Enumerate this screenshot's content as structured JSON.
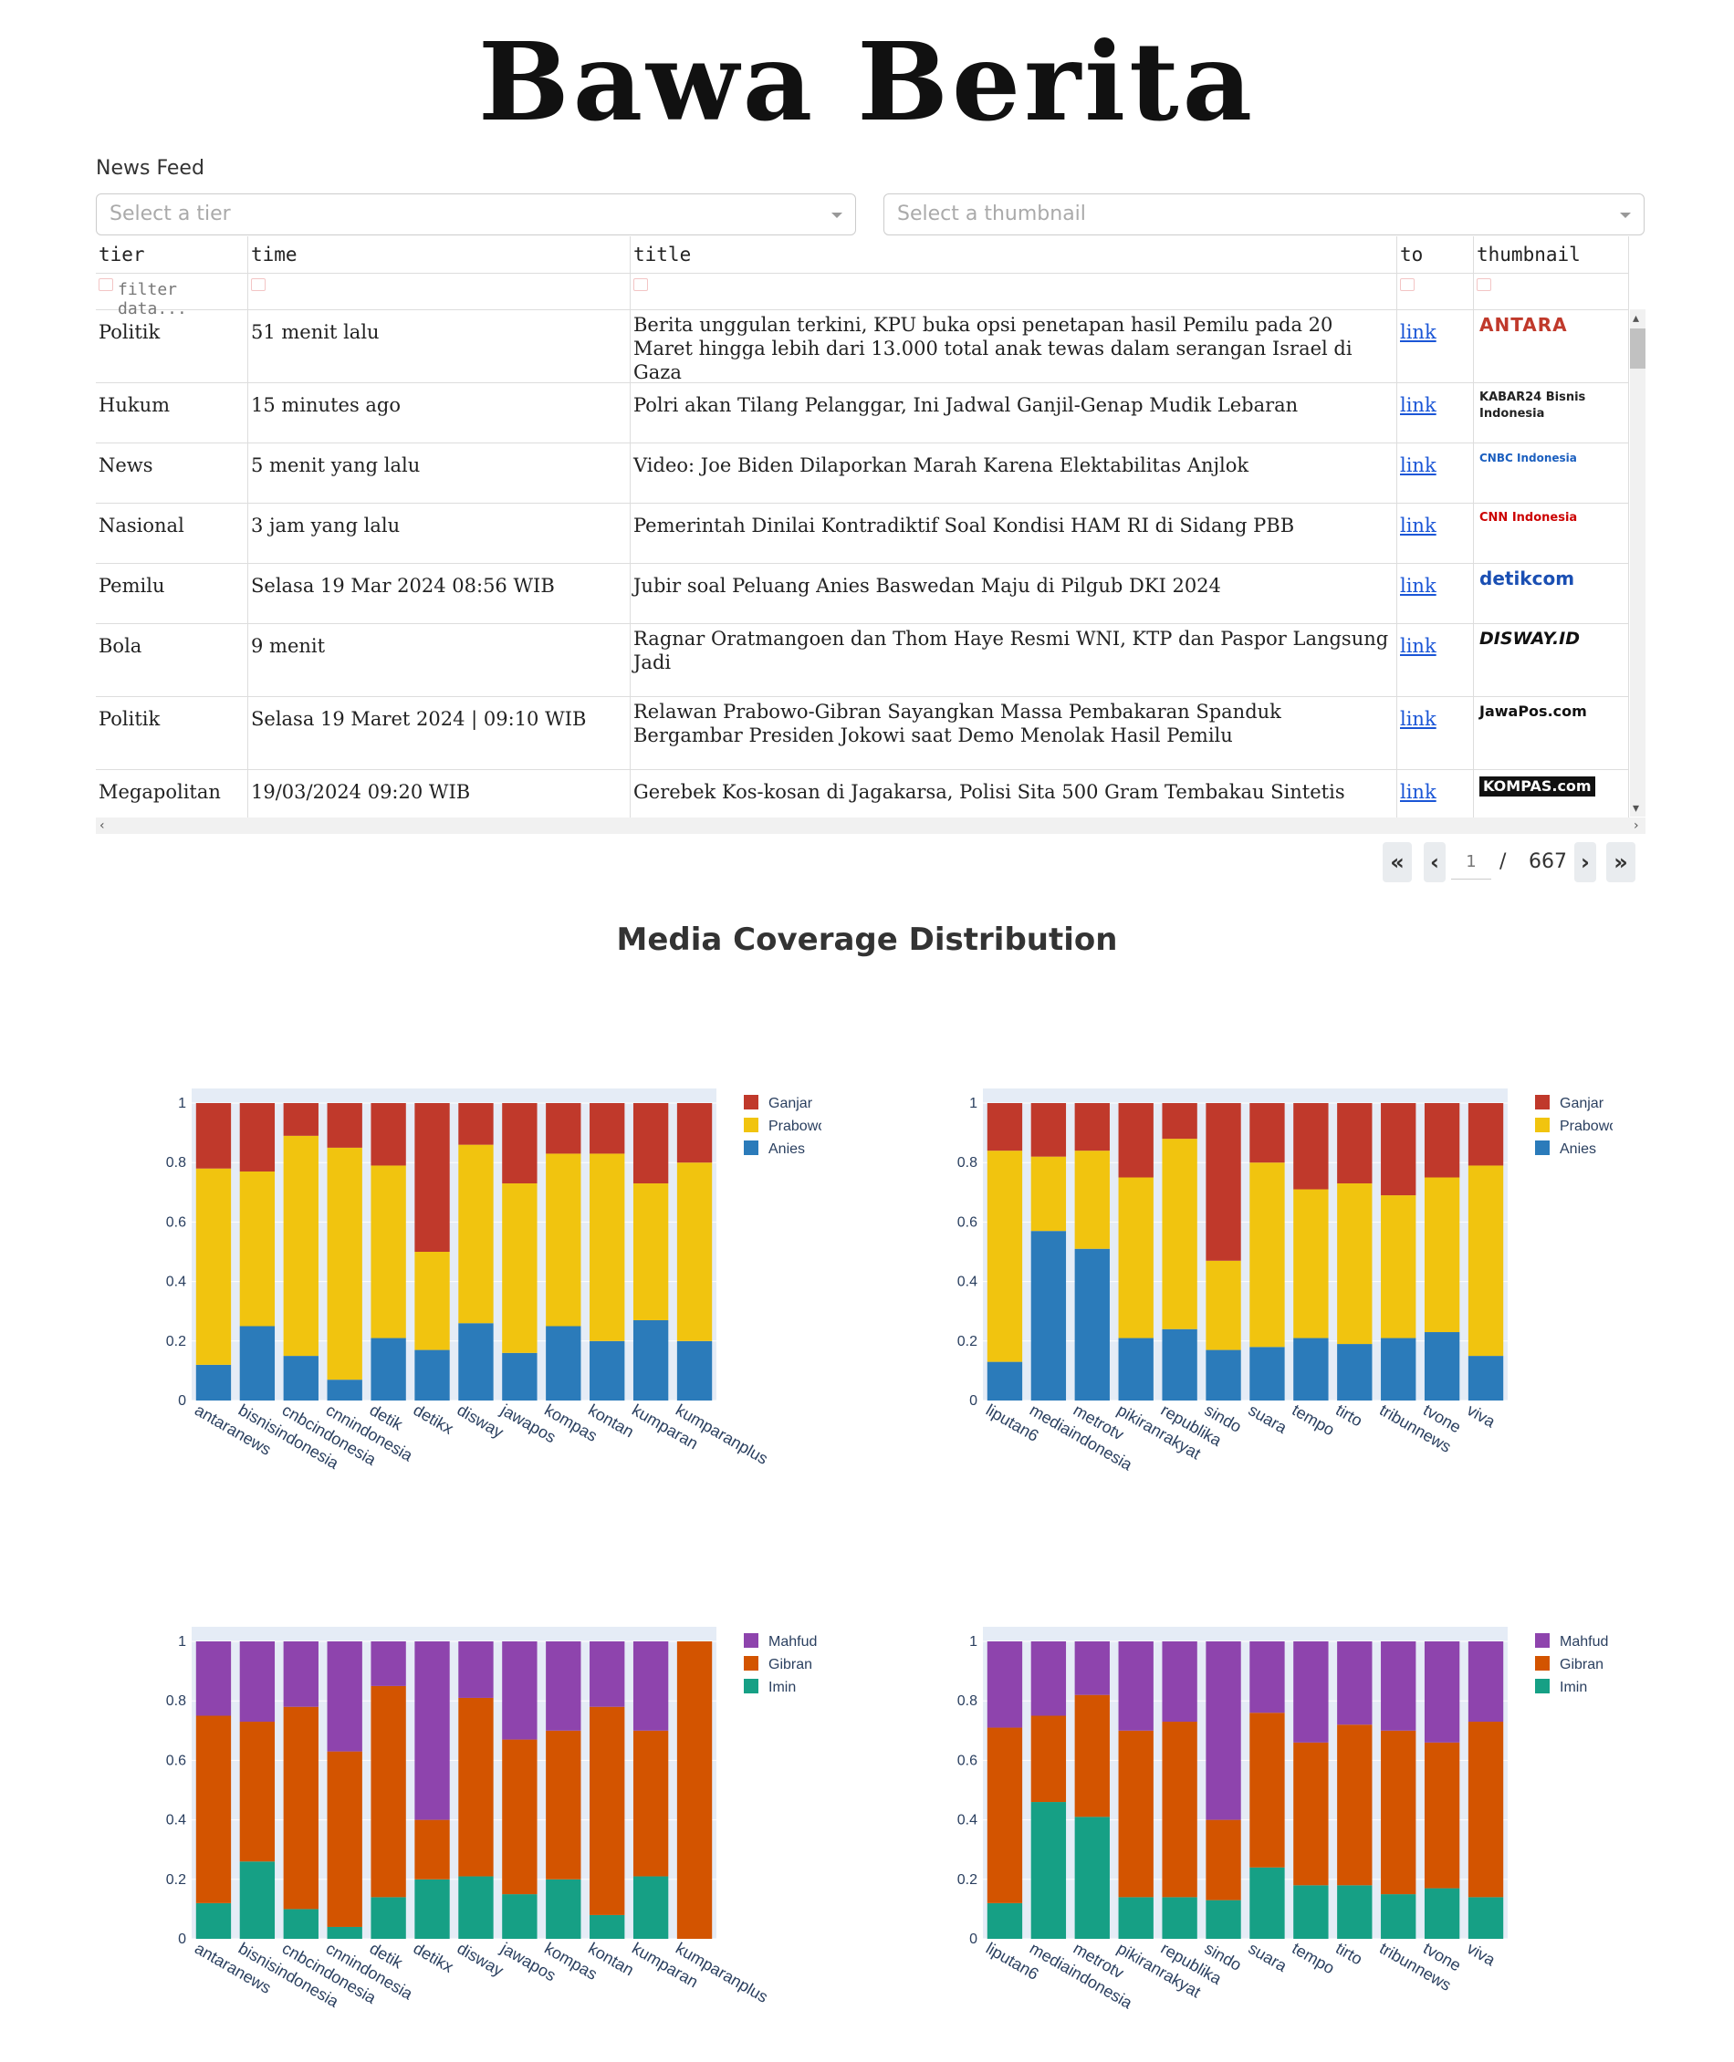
{
  "brand": {
    "title": "Bawa Berita"
  },
  "feed": {
    "label": "News Feed",
    "tier_select_placeholder": "Select a tier",
    "thumbnail_select_placeholder": "Select a thumbnail"
  },
  "table": {
    "columns": [
      "tier",
      "time",
      "title",
      "to",
      "thumbnail"
    ],
    "filter_placeholder": "filter data...",
    "rows": [
      {
        "tier": "Politik",
        "time": "51 menit lalu",
        "title": "Berita unggulan terkini, KPU buka opsi penetapan hasil Pemilu pada 20 Maret hingga lebih dari 13.000 total anak tewas dalam serangan Israel di Gaza",
        "to": "link",
        "thumbnail": "ANTARA"
      },
      {
        "tier": "Hukum",
        "time": "15 minutes ago",
        "title": "Polri akan Tilang Pelanggar, Ini Jadwal Ganjil-Genap Mudik Lebaran",
        "to": "link",
        "thumbnail": "KABAR24 Bisnis Indonesia"
      },
      {
        "tier": "News",
        "time": "5 menit yang lalu",
        "title": "Video: Joe Biden Dilaporkan Marah Karena Elektabilitas Anjlok",
        "to": "link",
        "thumbnail": "CNBC Indonesia"
      },
      {
        "tier": "Nasional",
        "time": "3 jam yang lalu",
        "title": "Pemerintah Dinilai Kontradiktif Soal Kondisi HAM RI di Sidang PBB",
        "to": "link",
        "thumbnail": "CNN Indonesia"
      },
      {
        "tier": "Pemilu",
        "time": "Selasa 19 Mar 2024 08:56 WIB",
        "title": "Jubir soal Peluang Anies Baswedan Maju di Pilgub DKI 2024",
        "to": "link",
        "thumbnail": "detikcom"
      },
      {
        "tier": "Bola",
        "time": "9 menit",
        "title": "Ragnar Oratmangoen dan Thom Haye Resmi WNI, KTP dan Paspor Langsung Jadi",
        "to": "link",
        "thumbnail": "DISWAY.ID"
      },
      {
        "tier": "Politik",
        "time": "Selasa 19 Maret 2024 | 09:10 WIB",
        "title": "Relawan Prabowo-Gibran Sayangkan Massa Pembakaran Spanduk Bergambar Presiden Jokowi saat Demo Menolak Hasil Pemilu",
        "to": "link",
        "thumbnail": "JawaPos.com"
      },
      {
        "tier": "Megapolitan",
        "time": "19/03/2024 09:20 WIB",
        "title": "Gerebek Kos-kosan di Jagakarsa, Polisi Sita 500 Gram Tembakau Sintetis",
        "to": "link",
        "thumbnail": "KOMPAS.com"
      }
    ]
  },
  "pager": {
    "current": "1",
    "slash": "/",
    "total": "667"
  },
  "section_title": "Media Coverage Distribution",
  "chart_data": [
    {
      "type": "bar",
      "stacked": true,
      "categories": [
        "antaranews",
        "bisnisindonesia",
        "cnbcindonesia",
        "cnnindonesia",
        "detik",
        "detikx",
        "disway",
        "jawapos",
        "kompas",
        "kontan",
        "kumparan",
        "kumparanplus"
      ],
      "series": [
        {
          "name": "Anies",
          "color": "#2b7bba",
          "values": [
            0.12,
            0.25,
            0.15,
            0.07,
            0.21,
            0.17,
            0.26,
            0.16,
            0.25,
            0.2,
            0.27,
            0.2
          ]
        },
        {
          "name": "Prabowo",
          "color": "#f1c40f",
          "values": [
            0.66,
            0.52,
            0.74,
            0.78,
            0.58,
            0.33,
            0.6,
            0.57,
            0.58,
            0.63,
            0.46,
            0.6
          ]
        },
        {
          "name": "Ganjar",
          "color": "#c0392b",
          "values": [
            0.22,
            0.23,
            0.11,
            0.15,
            0.21,
            0.5,
            0.14,
            0.27,
            0.17,
            0.17,
            0.27,
            0.2
          ]
        }
      ],
      "ylim": [
        0,
        1
      ],
      "yticks": [
        "0",
        "0.2",
        "0.4",
        "0.6",
        "0.8",
        "1"
      ],
      "legend": "top-right"
    },
    {
      "type": "bar",
      "stacked": true,
      "categories": [
        "liputan6",
        "mediaindonesia",
        "metrotv",
        "pikiranrakyat",
        "republika",
        "sindo",
        "suara",
        "tempo",
        "tirto",
        "tribunnews",
        "tvone",
        "viva"
      ],
      "series": [
        {
          "name": "Anies",
          "color": "#2b7bba",
          "values": [
            0.13,
            0.57,
            0.51,
            0.21,
            0.24,
            0.17,
            0.18,
            0.21,
            0.19,
            0.21,
            0.23,
            0.15
          ]
        },
        {
          "name": "Prabowo",
          "color": "#f1c40f",
          "values": [
            0.71,
            0.25,
            0.33,
            0.54,
            0.64,
            0.3,
            0.62,
            0.5,
            0.54,
            0.48,
            0.52,
            0.64
          ]
        },
        {
          "name": "Ganjar",
          "color": "#c0392b",
          "values": [
            0.16,
            0.18,
            0.16,
            0.25,
            0.12,
            0.53,
            0.2,
            0.29,
            0.27,
            0.31,
            0.25,
            0.21
          ]
        }
      ],
      "ylim": [
        0,
        1
      ],
      "yticks": [
        "0",
        "0.2",
        "0.4",
        "0.6",
        "0.8",
        "1"
      ],
      "legend": "top-right"
    },
    {
      "type": "bar",
      "stacked": true,
      "categories": [
        "antaranews",
        "bisnisindonesia",
        "cnbcindonesia",
        "cnnindonesia",
        "detik",
        "detikx",
        "disway",
        "jawapos",
        "kompas",
        "kontan",
        "kumparan",
        "kumparanplus"
      ],
      "series": [
        {
          "name": "Imin",
          "color": "#16a085",
          "values": [
            0.12,
            0.26,
            0.1,
            0.04,
            0.14,
            0.2,
            0.21,
            0.15,
            0.2,
            0.08,
            0.21,
            0.0
          ]
        },
        {
          "name": "Gibran",
          "color": "#d35400",
          "values": [
            0.63,
            0.47,
            0.68,
            0.59,
            0.71,
            0.2,
            0.6,
            0.52,
            0.5,
            0.7,
            0.49,
            1.0
          ]
        },
        {
          "name": "Mahfud",
          "color": "#8e44ad",
          "values": [
            0.25,
            0.27,
            0.22,
            0.37,
            0.15,
            0.6,
            0.19,
            0.33,
            0.3,
            0.22,
            0.3,
            0.0
          ]
        }
      ],
      "ylim": [
        0,
        1
      ],
      "yticks": [
        "0",
        "0.2",
        "0.4",
        "0.6",
        "0.8",
        "1"
      ],
      "legend": "top-right"
    },
    {
      "type": "bar",
      "stacked": true,
      "categories": [
        "liputan6",
        "mediaindonesia",
        "metrotv",
        "pikiranrakyat",
        "republika",
        "sindo",
        "suara",
        "tempo",
        "tirto",
        "tribunnews",
        "tvone",
        "viva"
      ],
      "series": [
        {
          "name": "Imin",
          "color": "#16a085",
          "values": [
            0.12,
            0.46,
            0.41,
            0.14,
            0.14,
            0.13,
            0.24,
            0.18,
            0.18,
            0.15,
            0.17,
            0.14
          ]
        },
        {
          "name": "Gibran",
          "color": "#d35400",
          "values": [
            0.59,
            0.29,
            0.41,
            0.56,
            0.59,
            0.27,
            0.52,
            0.48,
            0.54,
            0.55,
            0.49,
            0.59
          ]
        },
        {
          "name": "Mahfud",
          "color": "#8e44ad",
          "values": [
            0.29,
            0.25,
            0.18,
            0.3,
            0.27,
            0.6,
            0.24,
            0.34,
            0.28,
            0.3,
            0.34,
            0.27
          ]
        }
      ],
      "ylim": [
        0,
        1
      ],
      "yticks": [
        "0",
        "0.2",
        "0.4",
        "0.6",
        "0.8",
        "1"
      ],
      "legend": "top-right"
    }
  ]
}
